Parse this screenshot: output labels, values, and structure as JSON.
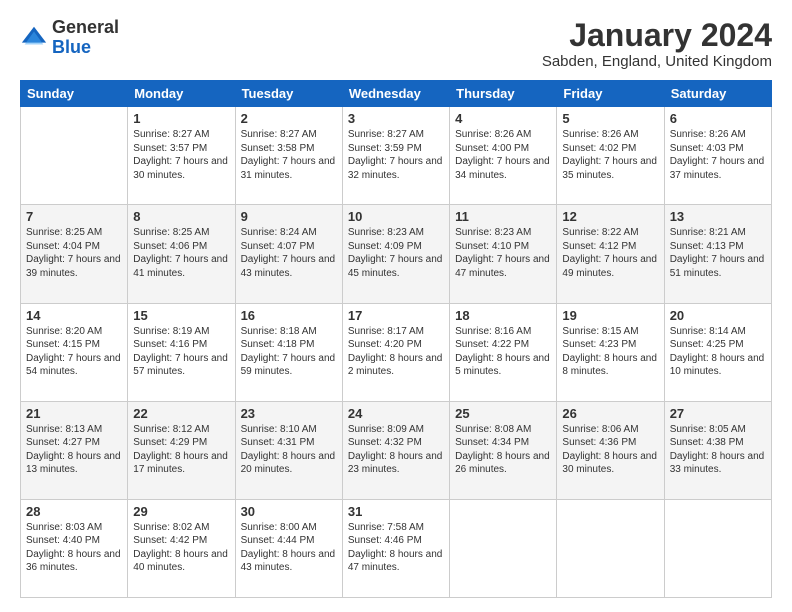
{
  "header": {
    "logo_general": "General",
    "logo_blue": "Blue",
    "month_title": "January 2024",
    "subtitle": "Sabden, England, United Kingdom"
  },
  "days_of_week": [
    "Sunday",
    "Monday",
    "Tuesday",
    "Wednesday",
    "Thursday",
    "Friday",
    "Saturday"
  ],
  "weeks": [
    [
      {
        "day": "",
        "sunrise": "",
        "sunset": "",
        "daylight": ""
      },
      {
        "day": "1",
        "sunrise": "Sunrise: 8:27 AM",
        "sunset": "Sunset: 3:57 PM",
        "daylight": "Daylight: 7 hours and 30 minutes."
      },
      {
        "day": "2",
        "sunrise": "Sunrise: 8:27 AM",
        "sunset": "Sunset: 3:58 PM",
        "daylight": "Daylight: 7 hours and 31 minutes."
      },
      {
        "day": "3",
        "sunrise": "Sunrise: 8:27 AM",
        "sunset": "Sunset: 3:59 PM",
        "daylight": "Daylight: 7 hours and 32 minutes."
      },
      {
        "day": "4",
        "sunrise": "Sunrise: 8:26 AM",
        "sunset": "Sunset: 4:00 PM",
        "daylight": "Daylight: 7 hours and 34 minutes."
      },
      {
        "day": "5",
        "sunrise": "Sunrise: 8:26 AM",
        "sunset": "Sunset: 4:02 PM",
        "daylight": "Daylight: 7 hours and 35 minutes."
      },
      {
        "day": "6",
        "sunrise": "Sunrise: 8:26 AM",
        "sunset": "Sunset: 4:03 PM",
        "daylight": "Daylight: 7 hours and 37 minutes."
      }
    ],
    [
      {
        "day": "7",
        "sunrise": "Sunrise: 8:25 AM",
        "sunset": "Sunset: 4:04 PM",
        "daylight": "Daylight: 7 hours and 39 minutes."
      },
      {
        "day": "8",
        "sunrise": "Sunrise: 8:25 AM",
        "sunset": "Sunset: 4:06 PM",
        "daylight": "Daylight: 7 hours and 41 minutes."
      },
      {
        "day": "9",
        "sunrise": "Sunrise: 8:24 AM",
        "sunset": "Sunset: 4:07 PM",
        "daylight": "Daylight: 7 hours and 43 minutes."
      },
      {
        "day": "10",
        "sunrise": "Sunrise: 8:23 AM",
        "sunset": "Sunset: 4:09 PM",
        "daylight": "Daylight: 7 hours and 45 minutes."
      },
      {
        "day": "11",
        "sunrise": "Sunrise: 8:23 AM",
        "sunset": "Sunset: 4:10 PM",
        "daylight": "Daylight: 7 hours and 47 minutes."
      },
      {
        "day": "12",
        "sunrise": "Sunrise: 8:22 AM",
        "sunset": "Sunset: 4:12 PM",
        "daylight": "Daylight: 7 hours and 49 minutes."
      },
      {
        "day": "13",
        "sunrise": "Sunrise: 8:21 AM",
        "sunset": "Sunset: 4:13 PM",
        "daylight": "Daylight: 7 hours and 51 minutes."
      }
    ],
    [
      {
        "day": "14",
        "sunrise": "Sunrise: 8:20 AM",
        "sunset": "Sunset: 4:15 PM",
        "daylight": "Daylight: 7 hours and 54 minutes."
      },
      {
        "day": "15",
        "sunrise": "Sunrise: 8:19 AM",
        "sunset": "Sunset: 4:16 PM",
        "daylight": "Daylight: 7 hours and 57 minutes."
      },
      {
        "day": "16",
        "sunrise": "Sunrise: 8:18 AM",
        "sunset": "Sunset: 4:18 PM",
        "daylight": "Daylight: 7 hours and 59 minutes."
      },
      {
        "day": "17",
        "sunrise": "Sunrise: 8:17 AM",
        "sunset": "Sunset: 4:20 PM",
        "daylight": "Daylight: 8 hours and 2 minutes."
      },
      {
        "day": "18",
        "sunrise": "Sunrise: 8:16 AM",
        "sunset": "Sunset: 4:22 PM",
        "daylight": "Daylight: 8 hours and 5 minutes."
      },
      {
        "day": "19",
        "sunrise": "Sunrise: 8:15 AM",
        "sunset": "Sunset: 4:23 PM",
        "daylight": "Daylight: 8 hours and 8 minutes."
      },
      {
        "day": "20",
        "sunrise": "Sunrise: 8:14 AM",
        "sunset": "Sunset: 4:25 PM",
        "daylight": "Daylight: 8 hours and 10 minutes."
      }
    ],
    [
      {
        "day": "21",
        "sunrise": "Sunrise: 8:13 AM",
        "sunset": "Sunset: 4:27 PM",
        "daylight": "Daylight: 8 hours and 13 minutes."
      },
      {
        "day": "22",
        "sunrise": "Sunrise: 8:12 AM",
        "sunset": "Sunset: 4:29 PM",
        "daylight": "Daylight: 8 hours and 17 minutes."
      },
      {
        "day": "23",
        "sunrise": "Sunrise: 8:10 AM",
        "sunset": "Sunset: 4:31 PM",
        "daylight": "Daylight: 8 hours and 20 minutes."
      },
      {
        "day": "24",
        "sunrise": "Sunrise: 8:09 AM",
        "sunset": "Sunset: 4:32 PM",
        "daylight": "Daylight: 8 hours and 23 minutes."
      },
      {
        "day": "25",
        "sunrise": "Sunrise: 8:08 AM",
        "sunset": "Sunset: 4:34 PM",
        "daylight": "Daylight: 8 hours and 26 minutes."
      },
      {
        "day": "26",
        "sunrise": "Sunrise: 8:06 AM",
        "sunset": "Sunset: 4:36 PM",
        "daylight": "Daylight: 8 hours and 30 minutes."
      },
      {
        "day": "27",
        "sunrise": "Sunrise: 8:05 AM",
        "sunset": "Sunset: 4:38 PM",
        "daylight": "Daylight: 8 hours and 33 minutes."
      }
    ],
    [
      {
        "day": "28",
        "sunrise": "Sunrise: 8:03 AM",
        "sunset": "Sunset: 4:40 PM",
        "daylight": "Daylight: 8 hours and 36 minutes."
      },
      {
        "day": "29",
        "sunrise": "Sunrise: 8:02 AM",
        "sunset": "Sunset: 4:42 PM",
        "daylight": "Daylight: 8 hours and 40 minutes."
      },
      {
        "day": "30",
        "sunrise": "Sunrise: 8:00 AM",
        "sunset": "Sunset: 4:44 PM",
        "daylight": "Daylight: 8 hours and 43 minutes."
      },
      {
        "day": "31",
        "sunrise": "Sunrise: 7:58 AM",
        "sunset": "Sunset: 4:46 PM",
        "daylight": "Daylight: 8 hours and 47 minutes."
      },
      {
        "day": "",
        "sunrise": "",
        "sunset": "",
        "daylight": ""
      },
      {
        "day": "",
        "sunrise": "",
        "sunset": "",
        "daylight": ""
      },
      {
        "day": "",
        "sunrise": "",
        "sunset": "",
        "daylight": ""
      }
    ]
  ]
}
